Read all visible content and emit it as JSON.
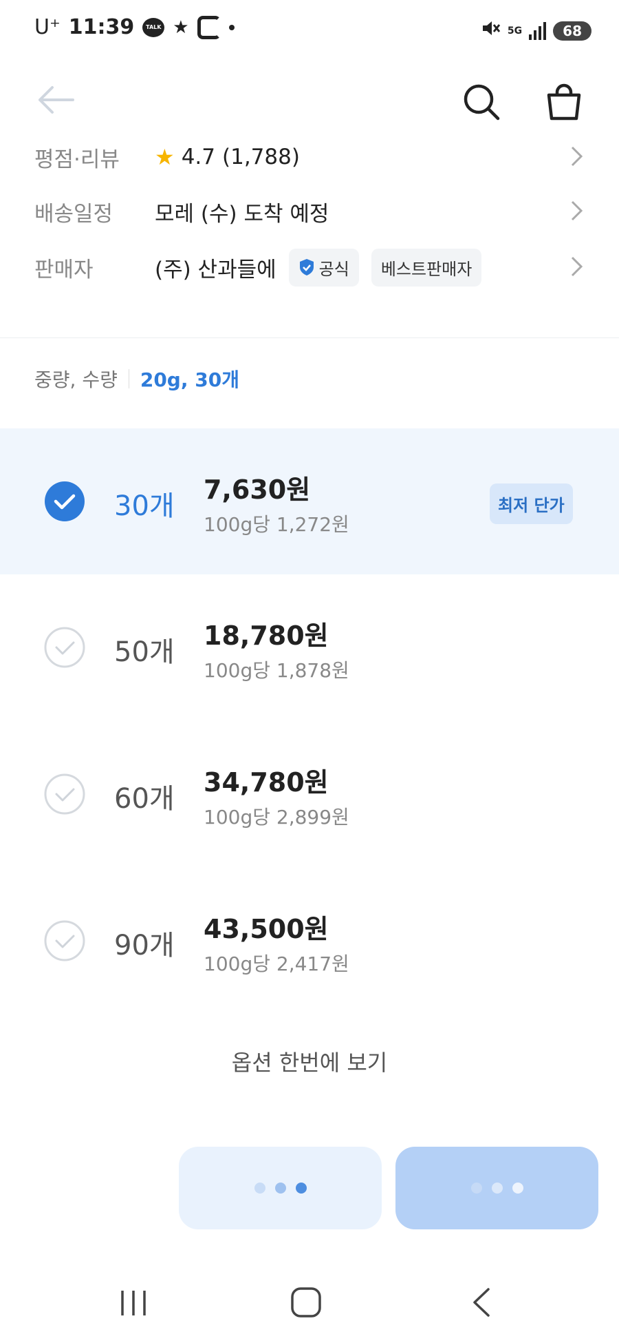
{
  "status_bar": {
    "carrier": "U⁺",
    "time": "11:39",
    "talk_icon_text": "TALK",
    "battery": "68",
    "network": "5G"
  },
  "header": {
    "icons": [
      "back-arrow-icon",
      "search-icon",
      "shopping-bag-icon"
    ]
  },
  "info": {
    "rating_label": "평점·리뷰",
    "rating_value": "4.7",
    "review_count": "(1,788)",
    "delivery_label": "배송일정",
    "delivery_value": "모레 (수) 도착 예정",
    "seller_label": "판매자",
    "seller_name": "(주) 산과들에",
    "official_badge": "공식",
    "best_seller_badge": "베스트판매자"
  },
  "filter": {
    "label": "중량, 수량",
    "value": "20g, 30개"
  },
  "options": [
    {
      "qty": "30개",
      "price": "7,630원",
      "unit_price": "100g당 1,272원",
      "badge": "최저 단가",
      "selected": true
    },
    {
      "qty": "50개",
      "price": "18,780원",
      "unit_price": "100g당 1,878원",
      "selected": false
    },
    {
      "qty": "60개",
      "price": "34,780원",
      "unit_price": "100g당 2,899원",
      "selected": false
    },
    {
      "qty": "90개",
      "price": "43,500원",
      "unit_price": "100g당 2,417원",
      "selected": false
    }
  ],
  "view_all_label": "옵션 한번에 보기",
  "colors": {
    "accent": "#2e7bd9",
    "selected_bg": "#f0f6fd",
    "star": "#f7b500"
  }
}
